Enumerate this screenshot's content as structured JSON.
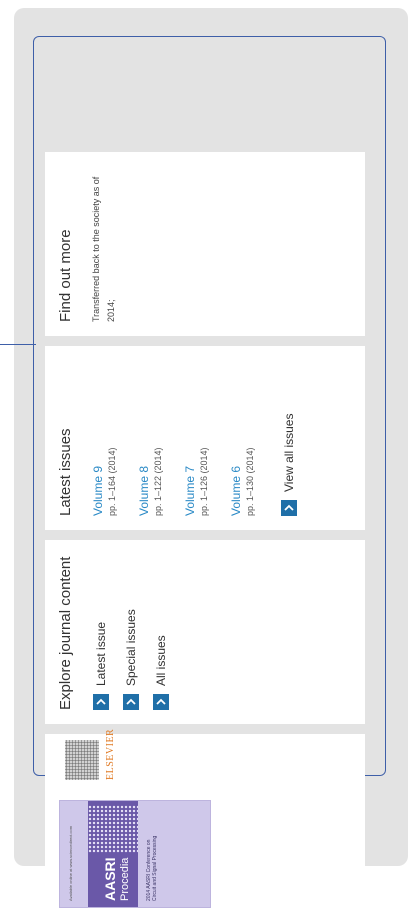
{
  "colors": {
    "accent": "#1f6fa8",
    "link": "#2b8ac6",
    "frame": "#3e5fa8"
  },
  "cover": {
    "journal_title_line1": "AASRI",
    "journal_title_line2": "Procedia",
    "publisher_logo": "ELSEVIER"
  },
  "explore": {
    "heading": "Explore journal content",
    "links": [
      "Latest issue",
      "Special issues",
      "All issues"
    ]
  },
  "latest": {
    "heading": "Latest issues",
    "volumes": [
      {
        "name": "Volume 9",
        "pages": "pp. 1–164 (2014)"
      },
      {
        "name": "Volume 8",
        "pages": "pp. 1–122 (2014)"
      },
      {
        "name": "Volume 7",
        "pages": "pp. 1–126 (2014)"
      },
      {
        "name": "Volume 6",
        "pages": "pp. 1–130 (2014)"
      }
    ],
    "view_all": "View all issues"
  },
  "more": {
    "heading": "Find out more",
    "text": "Transferred back to the society as of 2014;"
  }
}
